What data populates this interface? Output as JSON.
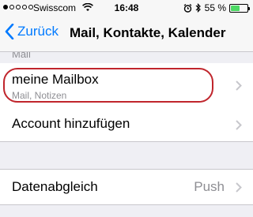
{
  "status": {
    "carrier": "Swisscom",
    "time": "16:48",
    "battery_text": "55 %",
    "battery_level": 0.55,
    "signal_dots_filled": 1,
    "signal_dots_total": 5
  },
  "nav": {
    "back_label": "Zurück",
    "title": "Mail, Kontakte, Kalender"
  },
  "list": {
    "clipped_label": "Mail",
    "account": {
      "title": "meine Mailbox",
      "subtitle": "Mail, Notizen"
    },
    "add_account": "Account hinzufügen",
    "sync": {
      "label": "Datenabgleich",
      "value": "Push"
    }
  },
  "colors": {
    "accent": "#007aff",
    "highlight": "#c0252c",
    "secondary_text": "#8e8e93",
    "battery_fill": "#4cd964"
  },
  "icons": {
    "back": "chevron-left-icon",
    "disclosure": "chevron-right-icon",
    "wifi": "wifi-icon",
    "alarm": "alarm-icon",
    "bluetooth": "bluetooth-icon",
    "battery": "battery-icon"
  }
}
